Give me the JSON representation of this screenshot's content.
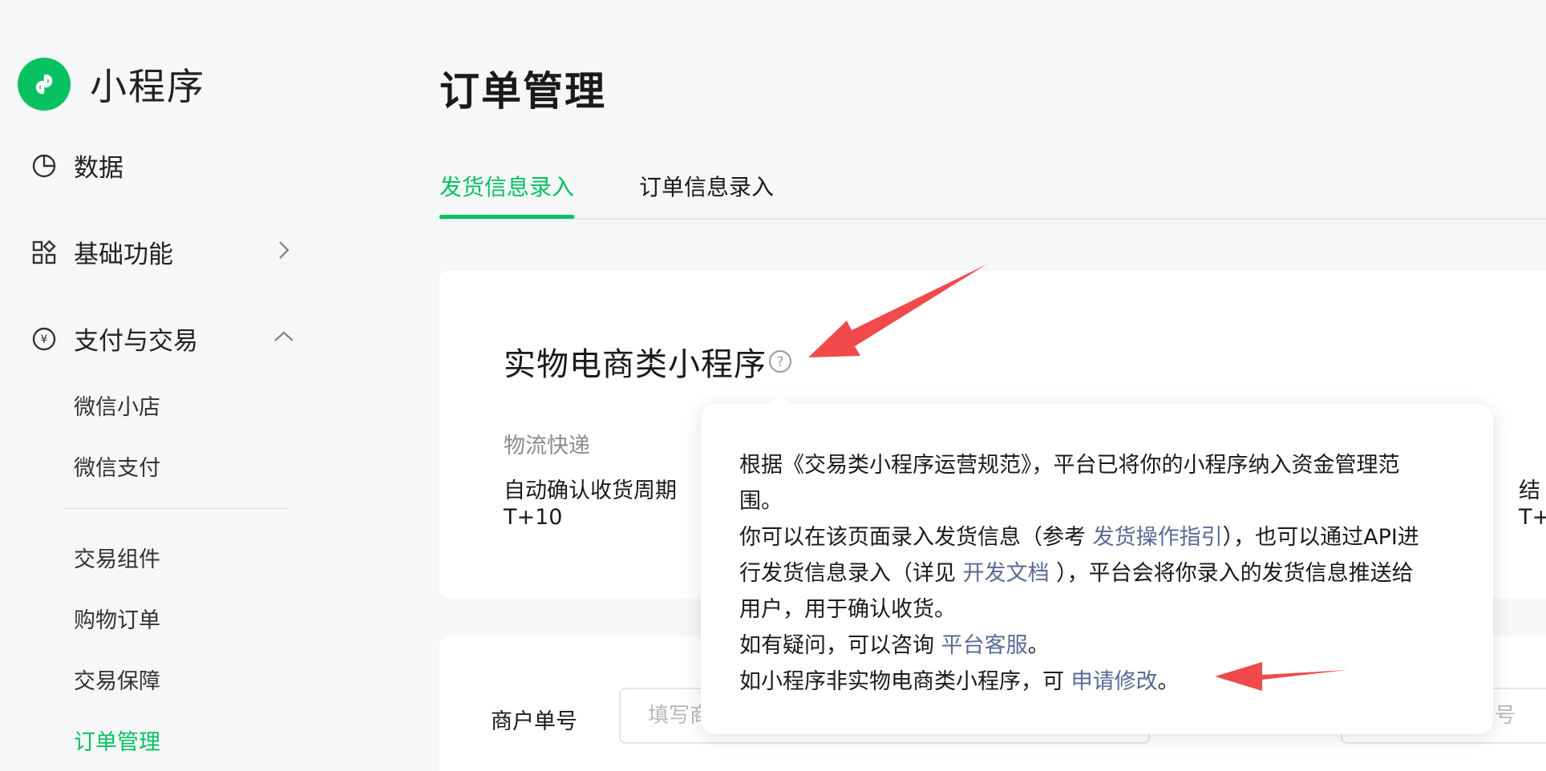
{
  "app": {
    "name": "小程序"
  },
  "sidebar": {
    "items": [
      {
        "label": "数据",
        "icon": "pie-chart-icon"
      },
      {
        "label": "基础功能",
        "icon": "grid-icon"
      },
      {
        "label": "支付与交易",
        "icon": "yuan-circle-icon"
      }
    ],
    "sub_items": [
      "微信小店",
      "微信支付",
      "交易组件",
      "购物订单",
      "交易保障",
      "订单管理"
    ],
    "active_sub": "订单管理"
  },
  "main": {
    "title": "订单管理",
    "tabs": [
      {
        "label": "发货信息录入",
        "active": true
      },
      {
        "label": "订单信息录入",
        "active": false
      }
    ],
    "section_title": "实物电商类小程序",
    "logistics_label": "物流快递",
    "auto_confirm_label": "自动确认收货周期",
    "auto_confirm_value": "T+10",
    "right_fragment_1": "结",
    "right_fragment_2": "T+",
    "merchant_label": "商户单号",
    "merchant_placeholder": "填写商",
    "right_input_placeholder": "号"
  },
  "popover": {
    "line1": "根据《交易类小程序运营规范》，平台已将你的小程序纳入资金管理范",
    "line2": "围。",
    "line3_pre": "你可以在该页面录入发货信息（参考 ",
    "line3_link": "发货操作指引",
    "line3_post": "），也可以通过API进",
    "line4_pre": "行发货信息录入（详见 ",
    "line4_link": "开发文档",
    "line4_post": " ），平台会将你录入的发货信息推送给",
    "line5": "用户，用于确认收货。",
    "line6_pre": "如有疑问，可以咨询 ",
    "line6_link": "平台客服",
    "line6_post": "。",
    "line7_pre": "如小程序非实物电商类小程序，可 ",
    "line7_link": "申请修改",
    "line7_post": "。"
  },
  "colors": {
    "brand_green": "#07c160",
    "link_blue": "#576b95",
    "annotation_red": "#f04a4a"
  }
}
